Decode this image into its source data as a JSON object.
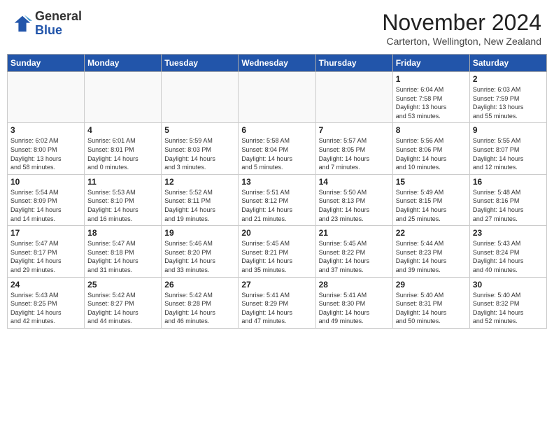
{
  "header": {
    "logo_general": "General",
    "logo_blue": "Blue",
    "month_title": "November 2024",
    "subtitle": "Carterton, Wellington, New Zealand"
  },
  "days_of_week": [
    "Sunday",
    "Monday",
    "Tuesday",
    "Wednesday",
    "Thursday",
    "Friday",
    "Saturday"
  ],
  "weeks": [
    [
      {
        "day": "",
        "info": ""
      },
      {
        "day": "",
        "info": ""
      },
      {
        "day": "",
        "info": ""
      },
      {
        "day": "",
        "info": ""
      },
      {
        "day": "",
        "info": ""
      },
      {
        "day": "1",
        "info": "Sunrise: 6:04 AM\nSunset: 7:58 PM\nDaylight: 13 hours\nand 53 minutes."
      },
      {
        "day": "2",
        "info": "Sunrise: 6:03 AM\nSunset: 7:59 PM\nDaylight: 13 hours\nand 55 minutes."
      }
    ],
    [
      {
        "day": "3",
        "info": "Sunrise: 6:02 AM\nSunset: 8:00 PM\nDaylight: 13 hours\nand 58 minutes."
      },
      {
        "day": "4",
        "info": "Sunrise: 6:01 AM\nSunset: 8:01 PM\nDaylight: 14 hours\nand 0 minutes."
      },
      {
        "day": "5",
        "info": "Sunrise: 5:59 AM\nSunset: 8:03 PM\nDaylight: 14 hours\nand 3 minutes."
      },
      {
        "day": "6",
        "info": "Sunrise: 5:58 AM\nSunset: 8:04 PM\nDaylight: 14 hours\nand 5 minutes."
      },
      {
        "day": "7",
        "info": "Sunrise: 5:57 AM\nSunset: 8:05 PM\nDaylight: 14 hours\nand 7 minutes."
      },
      {
        "day": "8",
        "info": "Sunrise: 5:56 AM\nSunset: 8:06 PM\nDaylight: 14 hours\nand 10 minutes."
      },
      {
        "day": "9",
        "info": "Sunrise: 5:55 AM\nSunset: 8:07 PM\nDaylight: 14 hours\nand 12 minutes."
      }
    ],
    [
      {
        "day": "10",
        "info": "Sunrise: 5:54 AM\nSunset: 8:09 PM\nDaylight: 14 hours\nand 14 minutes."
      },
      {
        "day": "11",
        "info": "Sunrise: 5:53 AM\nSunset: 8:10 PM\nDaylight: 14 hours\nand 16 minutes."
      },
      {
        "day": "12",
        "info": "Sunrise: 5:52 AM\nSunset: 8:11 PM\nDaylight: 14 hours\nand 19 minutes."
      },
      {
        "day": "13",
        "info": "Sunrise: 5:51 AM\nSunset: 8:12 PM\nDaylight: 14 hours\nand 21 minutes."
      },
      {
        "day": "14",
        "info": "Sunrise: 5:50 AM\nSunset: 8:13 PM\nDaylight: 14 hours\nand 23 minutes."
      },
      {
        "day": "15",
        "info": "Sunrise: 5:49 AM\nSunset: 8:15 PM\nDaylight: 14 hours\nand 25 minutes."
      },
      {
        "day": "16",
        "info": "Sunrise: 5:48 AM\nSunset: 8:16 PM\nDaylight: 14 hours\nand 27 minutes."
      }
    ],
    [
      {
        "day": "17",
        "info": "Sunrise: 5:47 AM\nSunset: 8:17 PM\nDaylight: 14 hours\nand 29 minutes."
      },
      {
        "day": "18",
        "info": "Sunrise: 5:47 AM\nSunset: 8:18 PM\nDaylight: 14 hours\nand 31 minutes."
      },
      {
        "day": "19",
        "info": "Sunrise: 5:46 AM\nSunset: 8:20 PM\nDaylight: 14 hours\nand 33 minutes."
      },
      {
        "day": "20",
        "info": "Sunrise: 5:45 AM\nSunset: 8:21 PM\nDaylight: 14 hours\nand 35 minutes."
      },
      {
        "day": "21",
        "info": "Sunrise: 5:45 AM\nSunset: 8:22 PM\nDaylight: 14 hours\nand 37 minutes."
      },
      {
        "day": "22",
        "info": "Sunrise: 5:44 AM\nSunset: 8:23 PM\nDaylight: 14 hours\nand 39 minutes."
      },
      {
        "day": "23",
        "info": "Sunrise: 5:43 AM\nSunset: 8:24 PM\nDaylight: 14 hours\nand 40 minutes."
      }
    ],
    [
      {
        "day": "24",
        "info": "Sunrise: 5:43 AM\nSunset: 8:25 PM\nDaylight: 14 hours\nand 42 minutes."
      },
      {
        "day": "25",
        "info": "Sunrise: 5:42 AM\nSunset: 8:27 PM\nDaylight: 14 hours\nand 44 minutes."
      },
      {
        "day": "26",
        "info": "Sunrise: 5:42 AM\nSunset: 8:28 PM\nDaylight: 14 hours\nand 46 minutes."
      },
      {
        "day": "27",
        "info": "Sunrise: 5:41 AM\nSunset: 8:29 PM\nDaylight: 14 hours\nand 47 minutes."
      },
      {
        "day": "28",
        "info": "Sunrise: 5:41 AM\nSunset: 8:30 PM\nDaylight: 14 hours\nand 49 minutes."
      },
      {
        "day": "29",
        "info": "Sunrise: 5:40 AM\nSunset: 8:31 PM\nDaylight: 14 hours\nand 50 minutes."
      },
      {
        "day": "30",
        "info": "Sunrise: 5:40 AM\nSunset: 8:32 PM\nDaylight: 14 hours\nand 52 minutes."
      }
    ]
  ]
}
